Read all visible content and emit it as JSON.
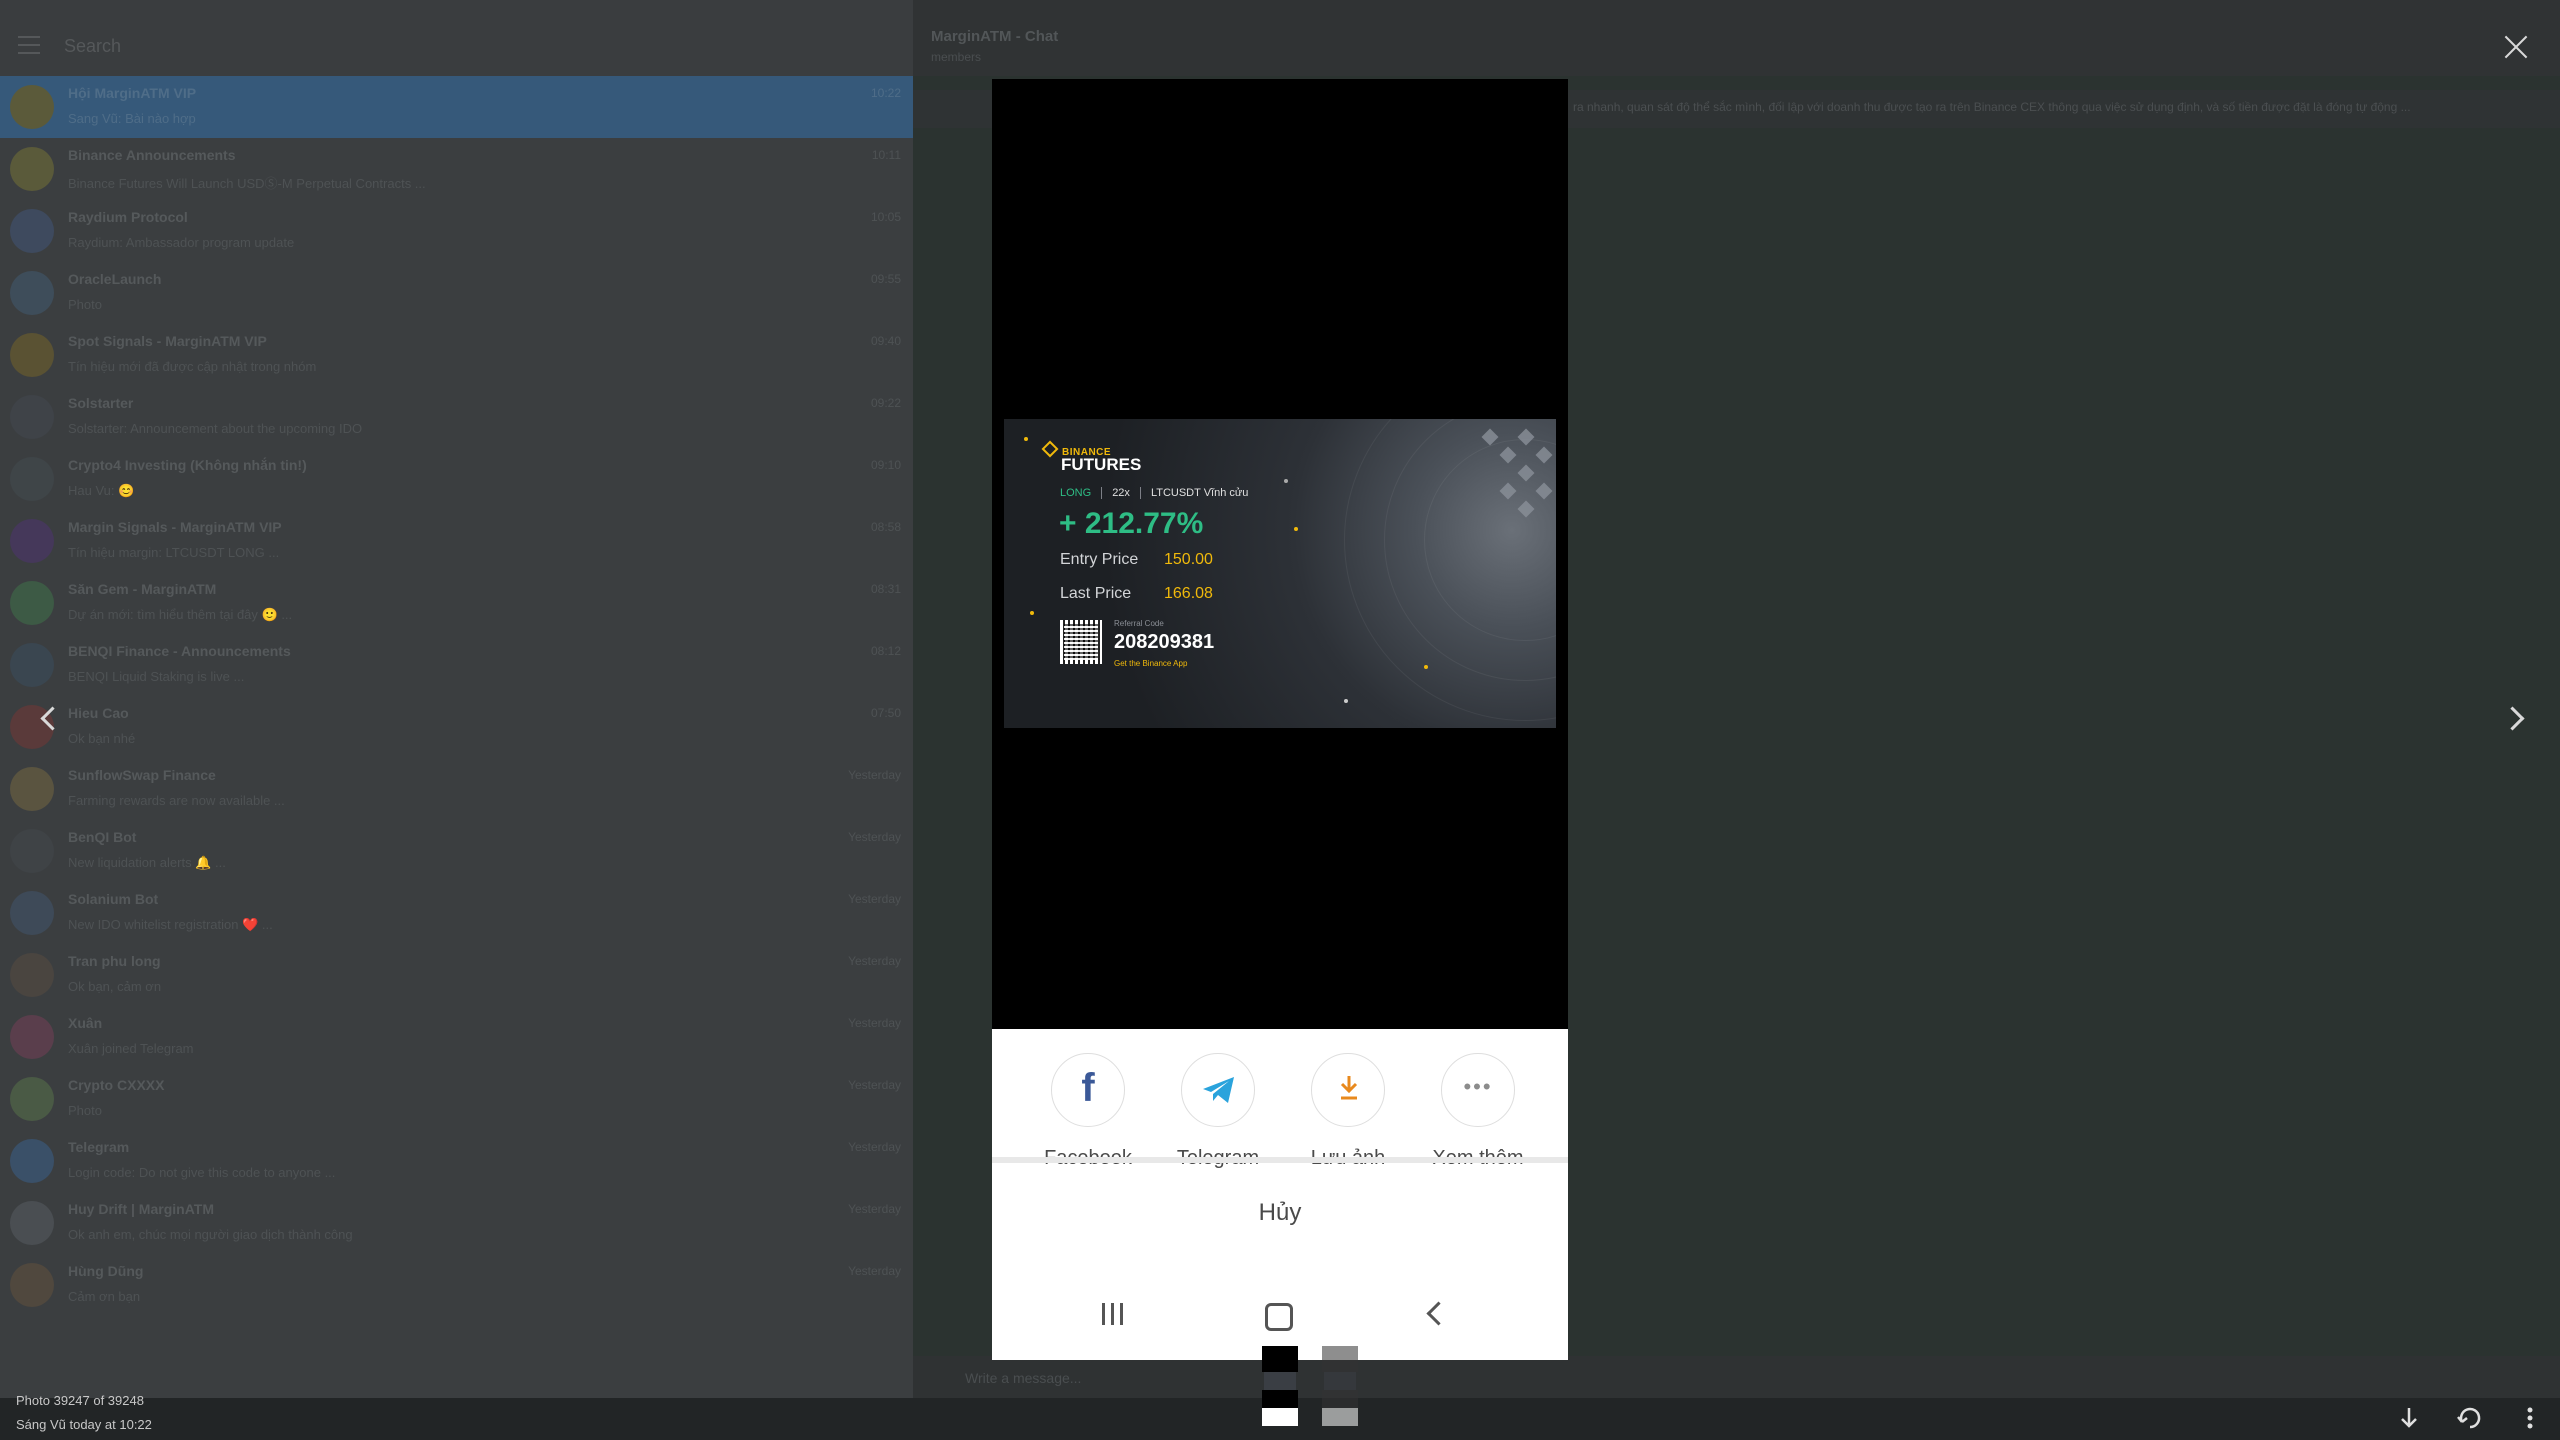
{
  "background": {
    "search_placeholder": "Search",
    "chat_title": "MarginATM - Chat",
    "chat_subtitle": "members",
    "pinned_text": "ra nhanh, quan sát độ thể sắc mình, đối lập với doanh thu được tạo ra trên Binance CEX thông qua việc sử dụng định, và số tiền được đặt là đóng tự động ...",
    "compose_placeholder": "Write a message...",
    "chats": [
      {
        "name": "Hội MarginATM VIP",
        "preview": "Sang Vũ: Bài nào hợp",
        "time": "10:22",
        "color": "#5b5a3a",
        "active": true
      },
      {
        "name": "Binance Announcements",
        "preview": "Binance Futures Will Launch USDⓈ-M Perpetual Contracts ...",
        "time": "10:11",
        "color": "#5a5a3a"
      },
      {
        "name": "Raydium Protocol",
        "preview": "Raydium: Ambassador program update",
        "time": "10:05",
        "color": "#3e4a5e"
      },
      {
        "name": "OracleLaunch",
        "preview": "Photo",
        "time": "09:55",
        "color": "#3e4d5a"
      },
      {
        "name": "Spot Signals - MarginATM VIP",
        "preview": "Tín hiệu mới đã được cập nhật trong nhóm",
        "time": "09:40",
        "color": "#5a5233"
      },
      {
        "name": "Solstarter",
        "preview": "Solstarter: Announcement about the upcoming IDO",
        "time": "09:22",
        "color": "#3f4348"
      },
      {
        "name": "Crypto4 Investing (Không nhắn tin!)",
        "preview": "Hau Vu: 😊",
        "time": "09:10",
        "color": "#3f4548"
      },
      {
        "name": "Margin Signals - MarginATM VIP",
        "preview": "Tín hiệu margin: LTCUSDT LONG ...",
        "time": "08:58",
        "color": "#45385a"
      },
      {
        "name": "Săn Gem - MarginATM",
        "preview": "Dự án mới: tìm hiểu thêm tại đây 🙂 ...",
        "time": "08:31",
        "color": "#3d5a45"
      },
      {
        "name": "BENQI Finance - Announcements",
        "preview": "BENQI Liquid Staking is live ...",
        "time": "08:12",
        "color": "#3a4650"
      },
      {
        "name": "Hieu Cao",
        "preview": "Ok bạn nhé",
        "time": "07:50",
        "color": "#5a3a3a"
      },
      {
        "name": "SunflowSwap Finance",
        "preview": "Farming rewards are now available ...",
        "time": "Yesterday",
        "color": "#5a5440"
      },
      {
        "name": "BenQI Bot",
        "preview": "New liquidation alerts 🔔 ...",
        "time": "Yesterday",
        "color": "#3f4346"
      },
      {
        "name": "Solanium Bot",
        "preview": "New IDO whitelist registration ❤️ ...",
        "time": "Yesterday",
        "color": "#3e4a58"
      },
      {
        "name": "Tran phu long",
        "preview": "Ok bạn, cảm ơn",
        "time": "Yesterday",
        "color": "#4a4540"
      },
      {
        "name": "Xuân",
        "preview": "Xuân joined Telegram",
        "time": "Yesterday",
        "color": "#5a3e4c"
      },
      {
        "name": "Crypto CXXXX",
        "preview": "Photo",
        "time": "Yesterday",
        "color": "#4a5a45"
      },
      {
        "name": "Telegram",
        "preview": "Login code: Do not give this code to anyone ...",
        "time": "Yesterday",
        "color": "#3a5068"
      },
      {
        "name": "Huy Drift | MarginATM",
        "preview": "Ok anh em, chúc mọi người giao dịch thành công",
        "time": "Yesterday",
        "color": "#4a4e52"
      },
      {
        "name": "Hùng Dũng",
        "preview": "Cảm ơn bạn",
        "time": "Yesterday",
        "color": "#50483e"
      }
    ]
  },
  "viewer": {
    "photo_counter": "Photo 39247 of 39248",
    "photo_author": "Sáng Vũ  today at 10:22",
    "icons": {
      "close": "close-icon",
      "prev": "chevron-left-icon",
      "next": "chevron-right-icon",
      "download": "download-icon",
      "forward": "forward-icon",
      "more": "more-vertical-icon"
    }
  },
  "photo": {
    "card": {
      "brand": "BINANCE",
      "title": "FUTURES",
      "side": "LONG",
      "leverage": "22x",
      "symbol": "LTCUSDT Vĩnh cửu",
      "pnl": "+ 212.77%",
      "entry_label": "Entry Price",
      "entry_value": "150.00",
      "last_label": "Last Price",
      "last_value": "166.08",
      "ref_label": "Referral Code",
      "ref_code": "208209381",
      "ref_app": "Get the Binance App",
      "accent_green": "#2ebd85",
      "accent_yellow": "#f0b90b"
    },
    "share": {
      "items": [
        {
          "label": "Facebook",
          "icon": "facebook-icon"
        },
        {
          "label": "Telegram",
          "icon": "telegram-icon"
        },
        {
          "label": "Lưu ảnh",
          "icon": "download-icon"
        },
        {
          "label": "Xem thêm",
          "icon": "more-horizontal-icon"
        }
      ],
      "cancel": "Hủy"
    }
  }
}
